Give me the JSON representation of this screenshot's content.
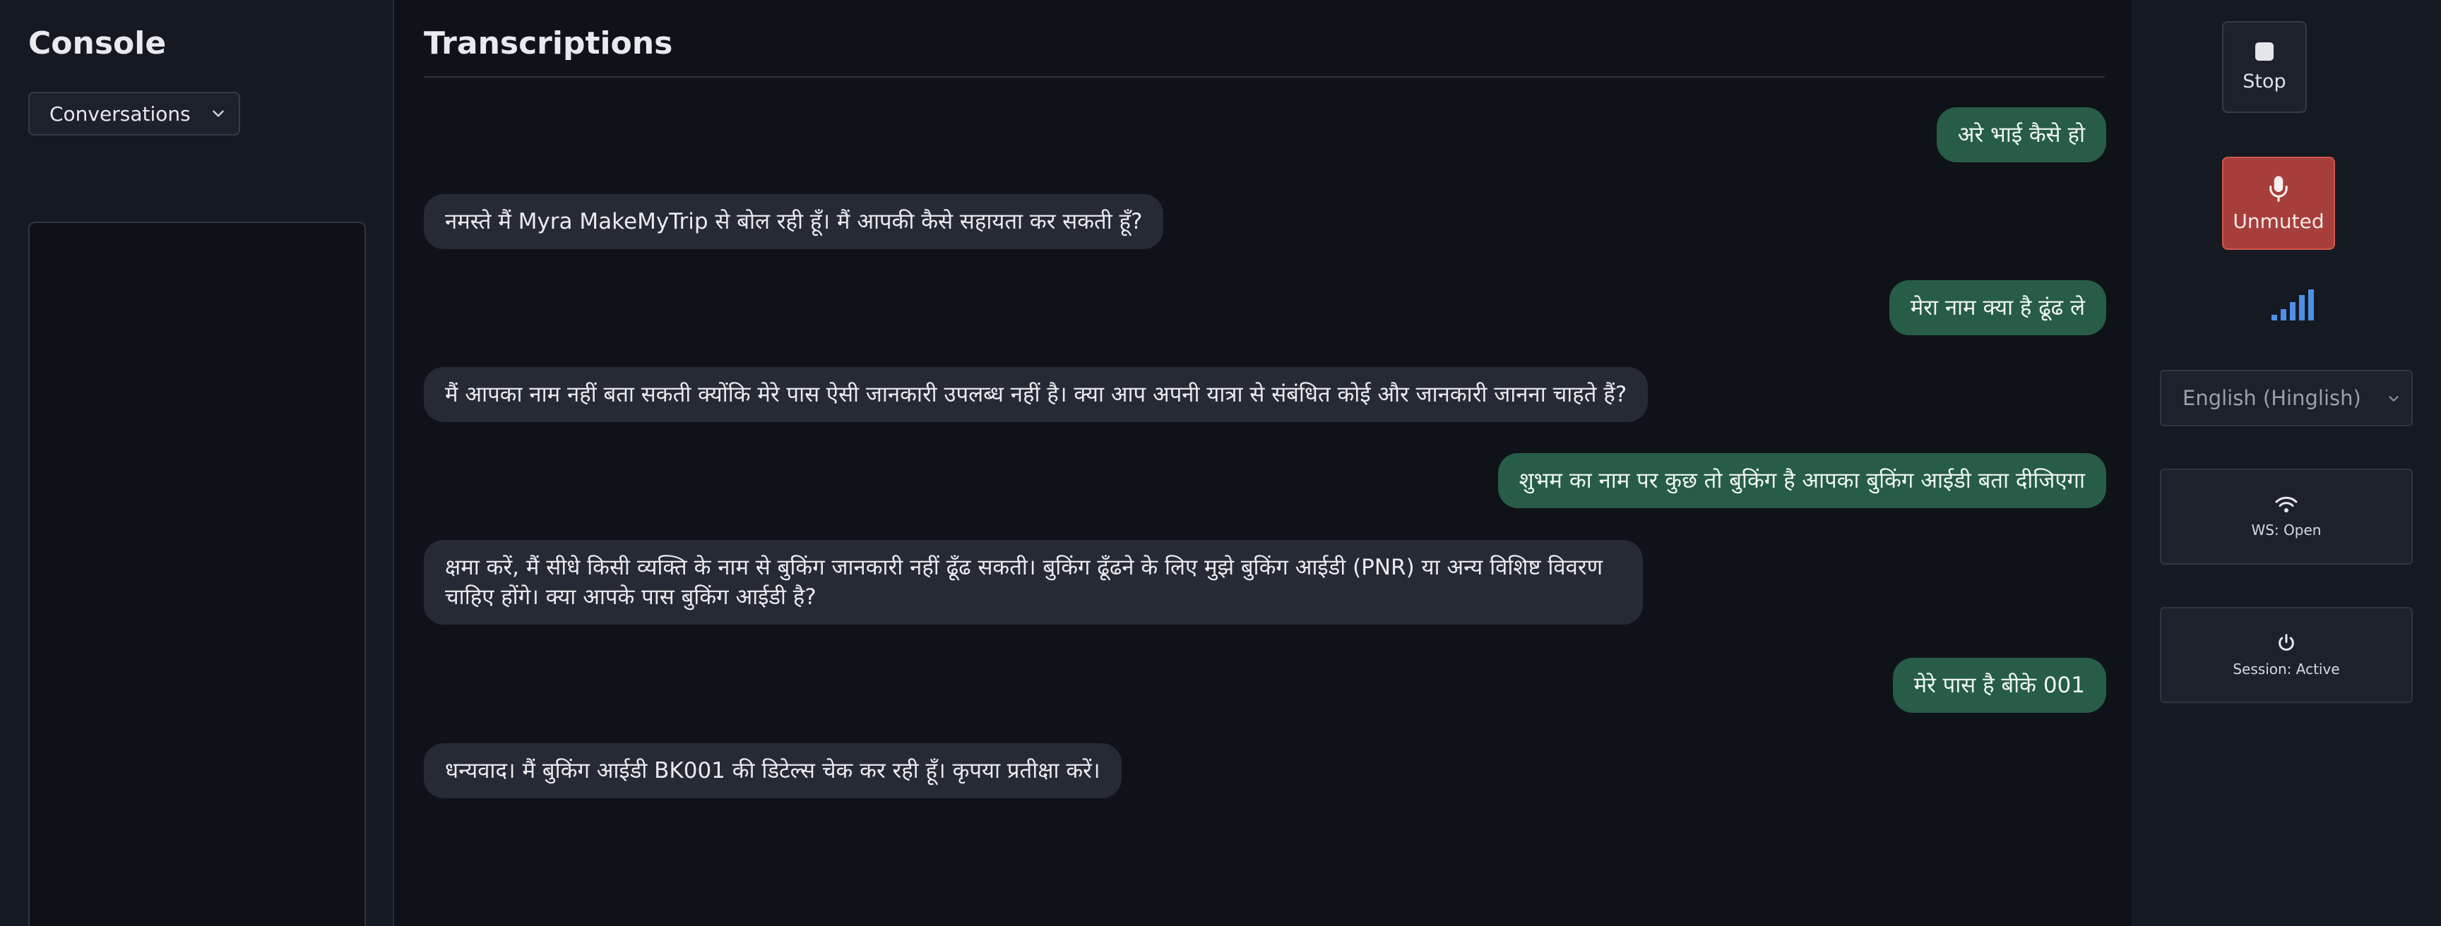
{
  "sidebar": {
    "title": "Console",
    "dropdown_value": "Conversations"
  },
  "main": {
    "heading": "Transcriptions",
    "messages": [
      {
        "role": "user",
        "text": "अरे भाई कैसे हो"
      },
      {
        "role": "assistant",
        "text": "नमस्ते मैं Myra MakeMyTrip से बोल रही हूँ। मैं आपकी कैसे सहायता कर सकती हूँ?"
      },
      {
        "role": "user",
        "text": "मेरा नाम क्या है ढूंढ ले"
      },
      {
        "role": "assistant",
        "text": "मैं आपका नाम नहीं बता सकती क्योंकि मेरे पास ऐसी जानकारी उपलब्ध नहीं है। क्या आप अपनी यात्रा से संबंधित कोई और जानकारी जानना चाहते हैं?"
      },
      {
        "role": "user",
        "text": "शुभम का नाम पर कुछ तो बुकिंग है आपका बुकिंग आईडी बता दीजिएगा"
      },
      {
        "role": "assistant",
        "text": "क्षमा करें, मैं सीधे किसी व्यक्ति के नाम से बुकिंग जानकारी नहीं ढूँढ सकती। बुकिंग ढूँढने के लिए मुझे बुकिंग आईडी (PNR) या अन्य विशिष्ट विवरण\nचाहिए होंगे। क्या आपके पास बुकिंग आईडी है?"
      },
      {
        "role": "user",
        "text": "मेरे पास है बीके 001"
      },
      {
        "role": "assistant",
        "text": "धन्यवाद। मैं बुकिंग आईडी BK001 की डिटेल्स चेक कर रही हूँ। कृपया प्रतीक्षा करें।"
      }
    ]
  },
  "controls": {
    "stop_label": "Stop",
    "mute_label": "Unmuted",
    "language_value": "English (Hinglish)",
    "ws_status": "WS: Open",
    "session_status": "Session: Active",
    "icons": {
      "stop": "stop-square-icon",
      "mic": "microphone-icon",
      "level": "audio-level-bars-icon",
      "ws": "wifi-icon",
      "session": "power-icon"
    }
  },
  "colors": {
    "background": "#0f1218",
    "panel": "#151922",
    "user_bubble": "#275c47",
    "assistant_bubble": "#252a34",
    "mute_button": "#a63f3b",
    "level_bars": "#4f8fe6"
  }
}
